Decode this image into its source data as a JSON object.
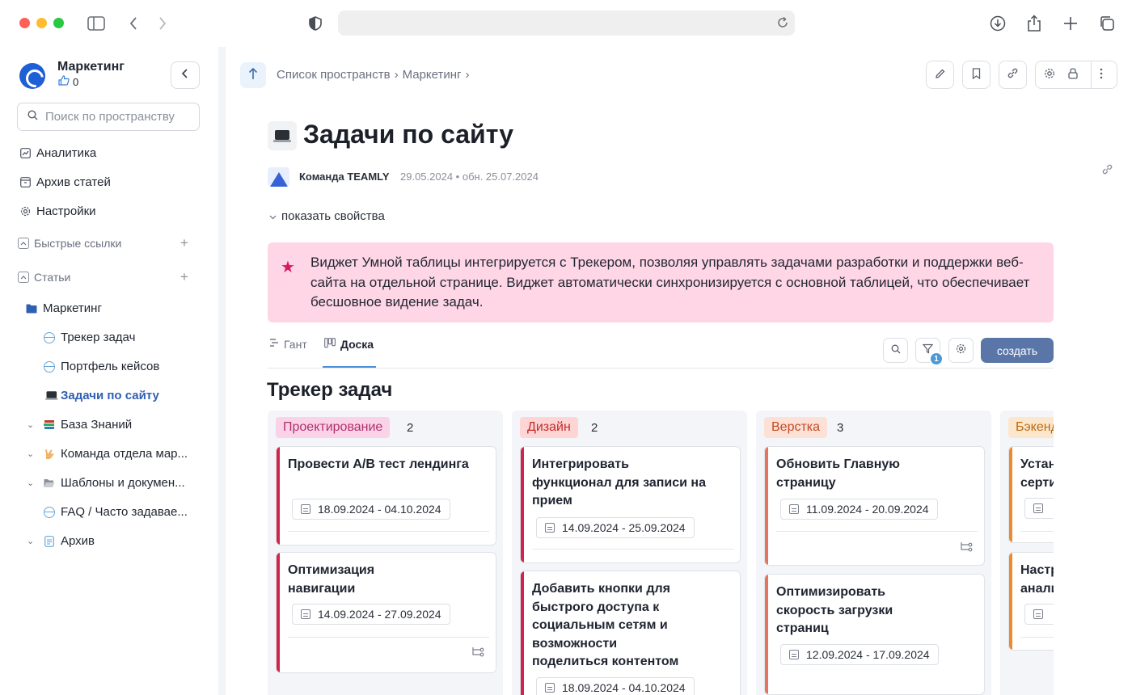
{
  "browser": {
    "dots": [
      "#ff5f57",
      "#febc2e",
      "#28c840"
    ]
  },
  "sidebar": {
    "space_name": "Маркетинг",
    "likes": "0",
    "search_placeholder": "Поиск по пространству",
    "nav": {
      "analytics": "Аналитика",
      "archive": "Архив статей",
      "settings": "Настройки"
    },
    "sections": {
      "quick_links": "Быстрые ссылки",
      "articles": "Статьи"
    },
    "tree": {
      "marketing": "Маркетинг",
      "tracker": "Трекер задач",
      "portfolio": "Портфель кейсов",
      "site_tasks": "Задачи по сайту",
      "knowledge": "База Знаний",
      "team": "Команда отдела мар...",
      "templates": "Шаблоны и докумен...",
      "faq": "FAQ / Часто задавае...",
      "archive": "Архив"
    },
    "active_color": "#2f5fb3"
  },
  "header": {
    "breadcrumb": [
      "Список пространств",
      "›",
      "Маркетинг",
      "›"
    ]
  },
  "page": {
    "title": "Задачи по сайту",
    "author": "Команда TEAMLY",
    "dates": "29.05.2024 • обн. 25.07.2024",
    "show_props": "показать свойства",
    "callout": "Виджет Умной таблицы интегрируется с Трекером, позволяя управлять задачами разработки и поддержки веб-сайта на отдельной странице. Виджет автоматически синхронизируется с основной таблицей, что обеспечивает бесшовное видение задач."
  },
  "widget": {
    "tabs": {
      "gantt": "Гант",
      "board": "Доска"
    },
    "filter_count": "1",
    "create_label": "создать",
    "board_title": "Трекер задач",
    "columns": [
      {
        "name": "Проектирование",
        "count": "2",
        "tag_bg": "#fbd3e9",
        "tag_color": "#b0306a",
        "bar_color": "#d0244e",
        "cards": [
          {
            "title": "Провести А/В тест лендинга",
            "date": "18.09.2024 - 04.10.2024"
          },
          {
            "title": "Оптимизация навигации",
            "date": "14.09.2024 - 27.09.2024"
          }
        ]
      },
      {
        "name": "Дизайн",
        "count": "2",
        "tag_bg": "#fdd5d5",
        "tag_color": "#c42a2a",
        "bar_color": "#d0244e",
        "cards": [
          {
            "title": "Интегрировать функционал для записи на прием",
            "date": "14.09.2024 - 25.09.2024"
          },
          {
            "title": "Добавить кнопки для быстрого доступа к социальным сетям и возможности поделиться контентом",
            "date": "18.09.2024 - 04.10.2024"
          }
        ]
      },
      {
        "name": "Верстка",
        "count": "3",
        "tag_bg": "#fde0d6",
        "tag_color": "#c44a24",
        "bar_color": "#e8735c",
        "cards": [
          {
            "title": "Обновить Главную страницу",
            "date": "11.09.2024 - 20.09.2024"
          },
          {
            "title": "Оптимизировать скорость загрузки страниц",
            "date": "12.09.2024 - 17.09.2024"
          }
        ]
      },
      {
        "name": "Бэкенд",
        "count": "",
        "tag_bg": "#fde7cc",
        "tag_color": "#b86a14",
        "bar_color": "#ef8a2c",
        "cards": [
          {
            "title": "Установить сертификат",
            "date": ""
          },
          {
            "title": "Настроить аналитику",
            "date": ""
          }
        ]
      }
    ]
  }
}
